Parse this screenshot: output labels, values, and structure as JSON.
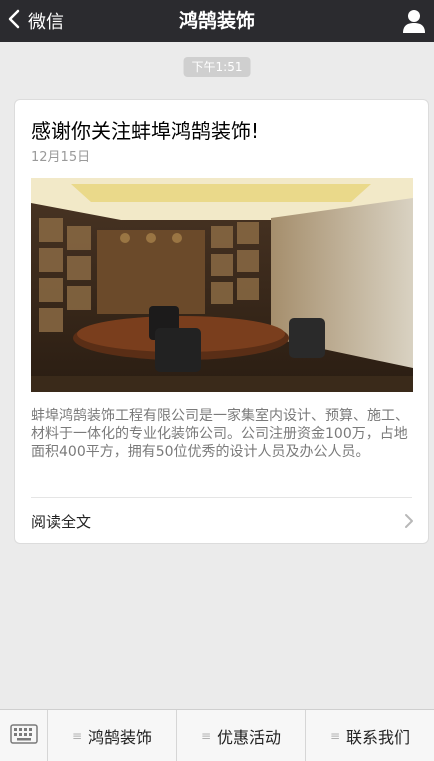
{
  "header": {
    "back_label": "微信",
    "title": "鸿鹄装饰"
  },
  "chat": {
    "timestamp": "下午1:51"
  },
  "article": {
    "title": "感谢你关注蚌埠鸿鹄装饰!",
    "date": "12月15日",
    "summary": "蚌埠鸿鹄装饰工程有限公司是一家集室内设计、预算、施工、材料于一体化的专业化装饰公司。公司注册资金100万，占地面积400平方，拥有50位优秀的设计人员及办公人员。",
    "read_more": "阅读全文"
  },
  "bottom_menu": {
    "items": [
      {
        "label": "鸿鹄装饰"
      },
      {
        "label": "优惠活动"
      },
      {
        "label": "联系我们"
      }
    ]
  },
  "icons": {
    "back": "chevron-left-icon",
    "profile": "person-icon",
    "keyboard": "keyboard-icon",
    "read_more": "chevron-right-icon",
    "menu": "menu-lines-icon"
  },
  "colors": {
    "nav_bg": "#2b2b2f",
    "page_bg": "#ebebeb",
    "time_badge": "#cfcfcf"
  }
}
